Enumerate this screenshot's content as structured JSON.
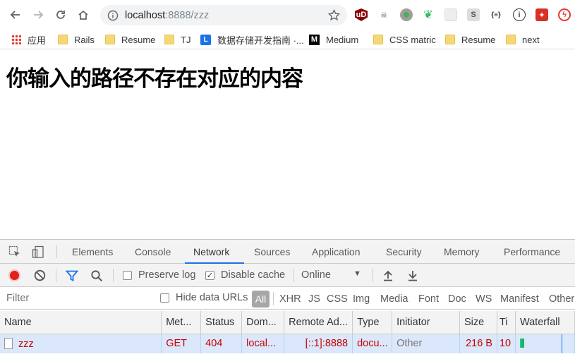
{
  "browser": {
    "url_host": "localhost",
    "url_path": ":8888/zzz",
    "bookmarks": [
      "应用",
      "Rails",
      "Resume",
      "TJ",
      "数据存储开发指南 ·...",
      "Medium",
      "CSS matric",
      "Resume",
      "next"
    ]
  },
  "page": {
    "heading": "你输入的路径不存在对应的内容"
  },
  "devtools": {
    "tabs": [
      "Elements",
      "Console",
      "Network",
      "Sources",
      "Application",
      "Security",
      "Memory",
      "Performance"
    ],
    "active_tab": "Network",
    "network_toolbar": {
      "preserve_log": "Preserve log",
      "disable_cache": "Disable cache",
      "throttle": "Online"
    },
    "filter": {
      "placeholder": "Filter",
      "hide_data_urls": "Hide data URLs",
      "types": [
        "All",
        "XHR",
        "JS",
        "CSS",
        "Img",
        "Media",
        "Font",
        "Doc",
        "WS",
        "Manifest",
        "Other"
      ]
    },
    "columns": [
      "Name",
      "Met...",
      "Status",
      "Dom...",
      "Remote Ad...",
      "Type",
      "Initiator",
      "Size",
      "Ti",
      "Waterfall"
    ],
    "rows": [
      {
        "name": "zzz",
        "method": "GET",
        "status": "404",
        "domain": "local...",
        "remote": "[::1]:8888",
        "type": "docu...",
        "initiator": "Other",
        "size": "216 B",
        "time": "10"
      }
    ]
  },
  "colors": {
    "accent": "#1a73e8",
    "error_text": "#c80000",
    "selected_row": "#dbe8fb"
  }
}
